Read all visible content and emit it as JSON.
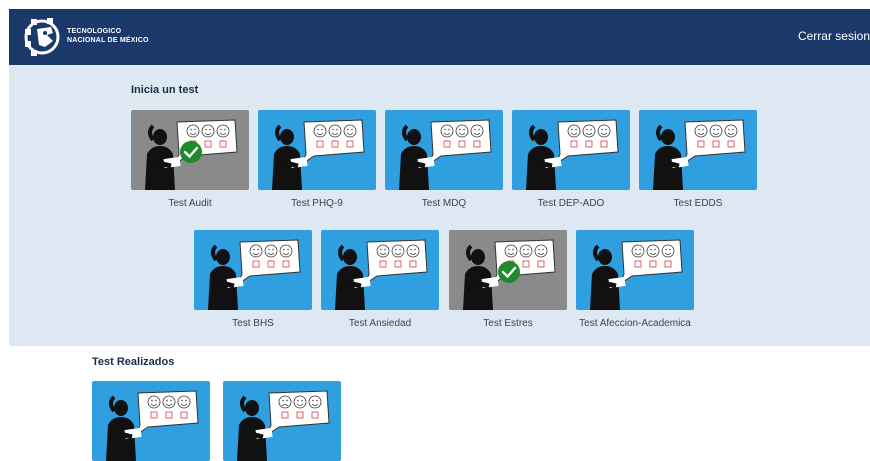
{
  "header": {
    "logo_line1": "TECNOLOGICO",
    "logo_line2": "NACIONAL DE MÉXICO",
    "logout_label": "Cerrar sesion"
  },
  "available": {
    "title": "Inicia un test",
    "tests": [
      {
        "label": "Test Audit",
        "completed": true
      },
      {
        "label": "Test PHQ-9",
        "completed": false
      },
      {
        "label": "Test MDQ",
        "completed": false
      },
      {
        "label": "Test DEP-ADO",
        "completed": false
      },
      {
        "label": "Test EDDS",
        "completed": false
      },
      {
        "label": "Test BHS",
        "completed": false
      },
      {
        "label": "Test Ansiedad",
        "completed": false
      },
      {
        "label": "Test Estres",
        "completed": true
      },
      {
        "label": "Test Afeccion-Academica",
        "completed": false
      }
    ]
  },
  "completed_section": {
    "title": "Test Realizados"
  },
  "colors": {
    "navbar": "#1b396a",
    "panel": "#dde8f2",
    "card_blue": "#2f9fe0",
    "card_gray": "#8a8a8a",
    "check_green": "#1e8a2e"
  }
}
